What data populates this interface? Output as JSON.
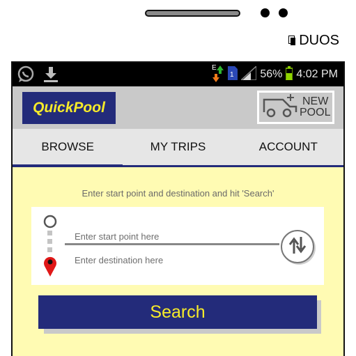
{
  "device": {
    "brand_label": "DUOS"
  },
  "status_bar": {
    "signal_sim": "1",
    "battery_percent": "56%",
    "time": "4:02 PM",
    "icons": [
      "whatsapp-icon",
      "download-icon",
      "data-transfer-icon",
      "sim-icon",
      "signal-icon",
      "battery-icon"
    ]
  },
  "app_bar": {
    "logo_text": "QuickPool",
    "new_pool_line1": "NEW",
    "new_pool_line2": "POOL"
  },
  "tabs": [
    {
      "label": "BROWSE",
      "active": true
    },
    {
      "label": "MY TRIPS",
      "active": false
    },
    {
      "label": "ACCOUNT",
      "active": false
    }
  ],
  "search_form": {
    "hint": "Enter start point and destination and hit 'Search'",
    "start_placeholder": "Enter start point here",
    "destination_placeholder": "Enter destination here",
    "search_label": "Search"
  },
  "colors": {
    "brand_navy": "#232b7a",
    "brand_yellow": "#f7eb2a",
    "content_background": "#fffbb3",
    "app_bar_gray": "#c9c9c9",
    "tab_bar_gray": "#e6e6e6",
    "location_pin_red": "#e01818",
    "battery_green": "#8fd400"
  }
}
